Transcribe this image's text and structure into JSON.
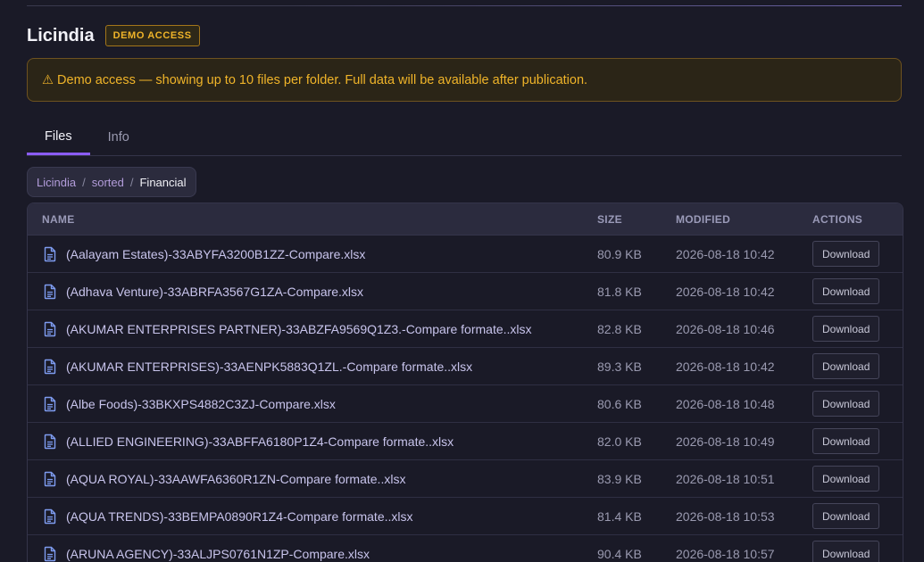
{
  "header": {
    "title": "Licindia",
    "badge": "DEMO ACCESS"
  },
  "notice": {
    "icon": "warning-icon",
    "text": "⚠ Demo access — showing up to 10 files per folder. Full data will be available after publication."
  },
  "tabs": [
    {
      "label": "Files",
      "active": true
    },
    {
      "label": "Info",
      "active": false
    }
  ],
  "breadcrumb": {
    "items": [
      "Licindia",
      "sorted"
    ],
    "current": "Financial",
    "separator": "/"
  },
  "table": {
    "headers": {
      "name": "NAME",
      "size": "SIZE",
      "modified": "MODIFIED",
      "actions": "ACTIONS"
    },
    "download_label": "Download",
    "rows": [
      {
        "name": "(Aalayam Estates)-33ABYFA3200B1ZZ-Compare.xlsx",
        "size": "80.9 KB",
        "modified": "2026-08-18 10:42"
      },
      {
        "name": "(Adhava Venture)-33ABRFA3567G1ZA-Compare.xlsx",
        "size": "81.8 KB",
        "modified": "2026-08-18 10:42"
      },
      {
        "name": "(AKUMAR ENTERPRISES PARTNER)-33ABZFA9569Q1Z3.-Compare formate..xlsx",
        "size": "82.8 KB",
        "modified": "2026-08-18 10:46"
      },
      {
        "name": "(AKUMAR ENTERPRISES)-33AENPK5883Q1ZL.-Compare formate..xlsx",
        "size": "89.3 KB",
        "modified": "2026-08-18 10:42"
      },
      {
        "name": "(Albe Foods)-33BKXPS4882C3ZJ-Compare.xlsx",
        "size": "80.6 KB",
        "modified": "2026-08-18 10:48"
      },
      {
        "name": "(ALLIED ENGINEERING)-33ABFFA6180P1Z4-Compare formate..xlsx",
        "size": "82.0 KB",
        "modified": "2026-08-18 10:49"
      },
      {
        "name": "(AQUA ROYAL)-33AAWFA6360R1ZN-Compare formate..xlsx",
        "size": "83.9 KB",
        "modified": "2026-08-18 10:51"
      },
      {
        "name": "(AQUA TRENDS)-33BEMPA0890R1Z4-Compare formate..xlsx",
        "size": "81.4 KB",
        "modified": "2026-08-18 10:53"
      },
      {
        "name": "(ARUNA AGENCY)-33ALJPS0761N1ZP-Compare.xlsx",
        "size": "90.4 KB",
        "modified": "2026-08-18 10:57"
      }
    ]
  },
  "colors": {
    "background": "#1a1a27",
    "accent": "#8b5cf6",
    "warning": "#f0b429",
    "link": "#b39ddb"
  }
}
